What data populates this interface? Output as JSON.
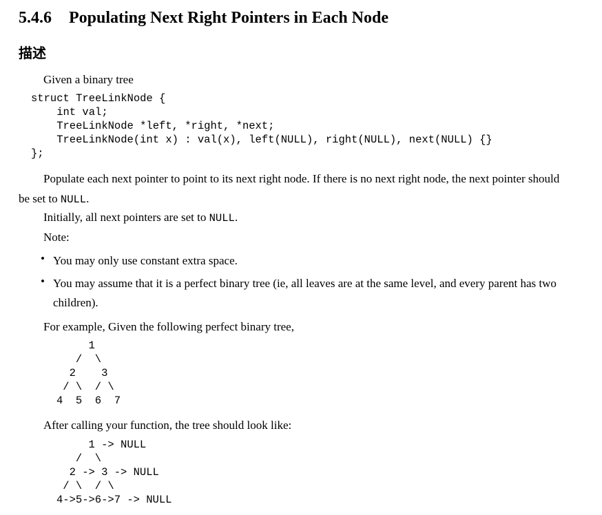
{
  "section": {
    "number": "5.4.6",
    "title": "Populating Next Right Pointers in Each Node"
  },
  "subsection": {
    "title": "描述"
  },
  "intro": "Given a binary tree",
  "struct_code": [
    "struct TreeLinkNode {",
    "    int val;",
    "    TreeLinkNode *left, *right, *next;",
    "    TreeLinkNode(int x) : val(x), left(NULL), right(NULL), next(NULL) {}",
    "};"
  ],
  "populate": {
    "text": "Populate each next pointer to point to its next right node. If there is no next right node, the next pointer should be set to ",
    "null_token": "NULL",
    "end": "."
  },
  "initially": {
    "text": "Initially, all next pointers are set to ",
    "null_token": "NULL",
    "end": "."
  },
  "note_label": "Note:",
  "bullets": [
    {
      "marker": "•",
      "text": "You may only use constant extra space."
    },
    {
      "marker": "•",
      "text": "You may assume that it is a perfect binary tree (ie, all leaves are at the same level, and every parent has two children)."
    }
  ],
  "example_intro": "For example, Given the following perfect binary tree,",
  "tree_before": [
    "     1",
    "   /  \\",
    "  2    3",
    " / \\  / \\",
    "4  5  6  7"
  ],
  "after_intro": "After calling your function, the tree should look like:",
  "tree_after": [
    "     1 -> NULL",
    "   /  \\",
    "  2 -> 3 -> NULL",
    " / \\  / \\",
    "4->5->6->7 -> NULL"
  ]
}
